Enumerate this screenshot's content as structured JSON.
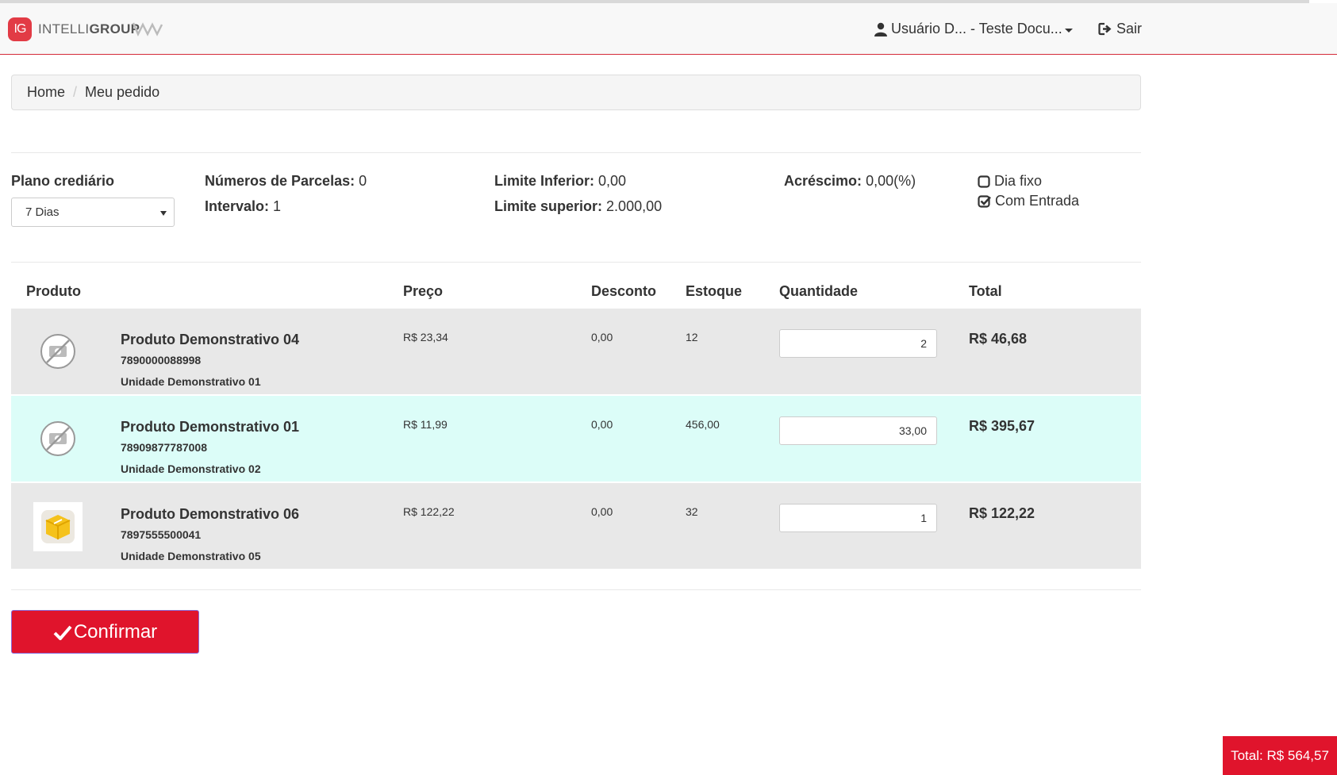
{
  "header": {
    "logo_badge": "IG",
    "logo_text_light": "INTELLI",
    "logo_text_bold": "GROUP",
    "user_label": "Usuário D... - Teste Docu...",
    "logout_label": "Sair"
  },
  "breadcrumb": {
    "home": "Home",
    "separator": "/",
    "current": "Meu pedido"
  },
  "plan": {
    "label": "Plano crediário",
    "selected": "7 Dias",
    "parcelas_label": "Números de Parcelas:",
    "parcelas_value": "0",
    "intervalo_label": "Intervalo:",
    "intervalo_value": "1",
    "limite_inferior_label": "Limite Inferior:",
    "limite_inferior_value": "0,00",
    "limite_superior_label": "Limite superior:",
    "limite_superior_value": "2.000,00",
    "acrescimo_label": "Acréscimo:",
    "acrescimo_value": "0,00(%)",
    "dia_fixo_label": "Dia fixo",
    "dia_fixo_checked": false,
    "com_entrada_label": "Com Entrada",
    "com_entrada_checked": true
  },
  "table": {
    "headers": {
      "produto": "Produto",
      "preco": "Preço",
      "desconto": "Desconto",
      "estoque": "Estoque",
      "quantidade": "Quantidade",
      "total": "Total"
    },
    "rows": [
      {
        "name": "Produto Demonstrativo 04",
        "code": "7890000088998",
        "unit": "Unidade Demonstrativo 01",
        "price": "R$ 23,34",
        "discount": "0,00",
        "stock": "12",
        "quantity": "2",
        "total": "R$ 46,68",
        "image": "no-image-icon"
      },
      {
        "name": "Produto Demonstrativo 01",
        "code": "78909877787008",
        "unit": "Unidade Demonstrativo 02",
        "price": "R$ 11,99",
        "discount": "0,00",
        "stock": "456,00",
        "quantity": "33,00",
        "total": "R$ 395,67",
        "image": "no-image-icon"
      },
      {
        "name": "Produto Demonstrativo 06",
        "code": "7897555500041",
        "unit": "Unidade Demonstrativo 05",
        "price": "R$ 122,22",
        "discount": "0,00",
        "stock": "32",
        "quantity": "1",
        "total": "R$ 122,22",
        "image": "product-box-image"
      }
    ]
  },
  "actions": {
    "confirm_label": "Confirmar"
  },
  "summary": {
    "total_label": "Total: R$ 564,57"
  },
  "colors": {
    "accent": "#e0142c",
    "row_alt": "#e8e8e8",
    "row_highlight": "#dcfdf8"
  }
}
